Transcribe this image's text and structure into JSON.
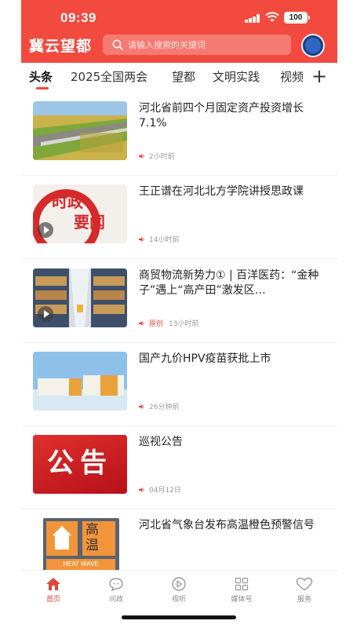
{
  "status": {
    "time": "09:39",
    "battery": "100"
  },
  "header": {
    "brand": "冀云望都",
    "search_placeholder": "请输入搜索的关键词"
  },
  "tabs": [
    "头条",
    "2025全国两会",
    "望都",
    "文明实践",
    "视频"
  ],
  "tab_more": "+",
  "feed": [
    {
      "title": "河北省前四个月固定资产投资增长7.1%",
      "time": "2小时前",
      "origin": ""
    },
    {
      "title": "王正谱在河北北方学院讲授思政课",
      "time": "14小时前",
      "origin": "",
      "thumb_text": [
        "时政",
        "要闻"
      ]
    },
    {
      "title": "商贸物流新势力① | 百洋医药：“金种子”遇上“高产田”激发区…",
      "time": "13小时前",
      "origin": "原创"
    },
    {
      "title": "国产九价HPV疫苗获批上市",
      "time": "26分钟前",
      "origin": ""
    },
    {
      "title": "巡视公告",
      "time": "04月12日",
      "origin": "",
      "thumb_text": "公告"
    },
    {
      "title": "河北省气象台发布高温橙色预警信号",
      "time": "",
      "origin": "",
      "thumb_text": [
        "高",
        "温",
        "HEAT WAVE"
      ]
    }
  ],
  "bottom_nav": [
    {
      "label": "首页",
      "icon": "home-icon"
    },
    {
      "label": "问政",
      "icon": "chat-icon"
    },
    {
      "label": "视听",
      "icon": "play-icon"
    },
    {
      "label": "媒体号",
      "icon": "grid-icon"
    },
    {
      "label": "服务",
      "icon": "heart-icon"
    }
  ],
  "colors": {
    "brand_red": "#f24a3e",
    "accent": "#e0463a"
  }
}
